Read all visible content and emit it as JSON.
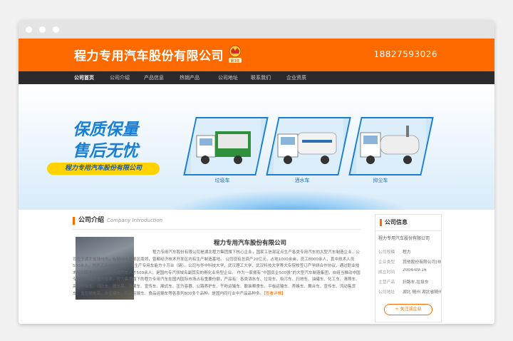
{
  "header": {
    "company_name": "程力专用汽车股份有限公司",
    "badge_text": "第3年",
    "phone": "18827593026"
  },
  "nav": {
    "items": [
      "公司首页",
      "公司介绍",
      "产品信息",
      "热销产品",
      "公司地址",
      "联系我们",
      "企业资质"
    ],
    "active_index": 0
  },
  "banner": {
    "slogan_line1": "保质保量",
    "slogan_line2": "售后无忧",
    "slogan_bar": "程力专用汽车股份有限公司",
    "trucks": [
      "垃圾车",
      "洒水车",
      "抑尘车"
    ]
  },
  "intro": {
    "section_title": "公司介绍",
    "section_subtitle": "Company Introduction",
    "article_title": "程力专用汽车股份有限公司",
    "article_text": "程力专用汽车股份有限公司是湖北程力集团旗下核心企业，国家工信部定点生产各类专用汽车的大型汽车制造企业，公司位于湖北省随州市，在随州市曾都区南郊，曾都经济技术开发区内有生产制造基地。 公司现有总资产20亿元，占地1000余亩，员工8000余人，其中技术人员500余人，技术工人2000余名，年生产专用车能力十万台（辆）。公司与华中科技大学、武汉理工大学、武汉科技大学等大专院校签订产学研合作协议，通过职业技术培训每年向社会输出各类汽车人才500余人，是国内专汽领域名副其实的孵化业务型企业。 作为一家拥有“中国民企500强”的大型汽车制造集团，自组当推动中国专用车发展的重大使命。程力集团旗下的程力专用汽车在国内国际市场占有重要份额，产品有：各类洒水车、垃圾车、吸污车、扫地车、油罐车、化工车、清障车、高空作业车、消防车、随车吊、冷藏车、宣传车、厢式车、压力容器、公路养护车、干粉运输车、散装粮食车、平板运输车、养蜂车、舞台车、宣传车、流动售货车、重型随车吊、水泥罐车、药品运输车、食品运输车等各系列800多个品种。是国内同行业中产品品种多。",
    "more_label": "【查看详情】"
  },
  "side": {
    "title": "公司信息",
    "company": "程力专用汽车股份有限公司",
    "rows": [
      {
        "k": "公司规模",
        "v": "程力"
      },
      {
        "k": "企业类型",
        "v": "其他股份有限公司(非上市)"
      },
      {
        "k": "成立时间",
        "v": "2004-09-16"
      },
      {
        "k": "主营产品",
        "v": "扫路车,垃圾车"
      },
      {
        "k": "公司地址",
        "v": "湖北 随州 湖北省随州市"
      }
    ],
    "follow_label": "+ 关注该企业"
  },
  "colors": {
    "brand": "#ff6a00",
    "nav_bg": "#2b2b2b",
    "accent_blue": "#1a7fd2",
    "slogan_yellow": "#ffd200"
  }
}
